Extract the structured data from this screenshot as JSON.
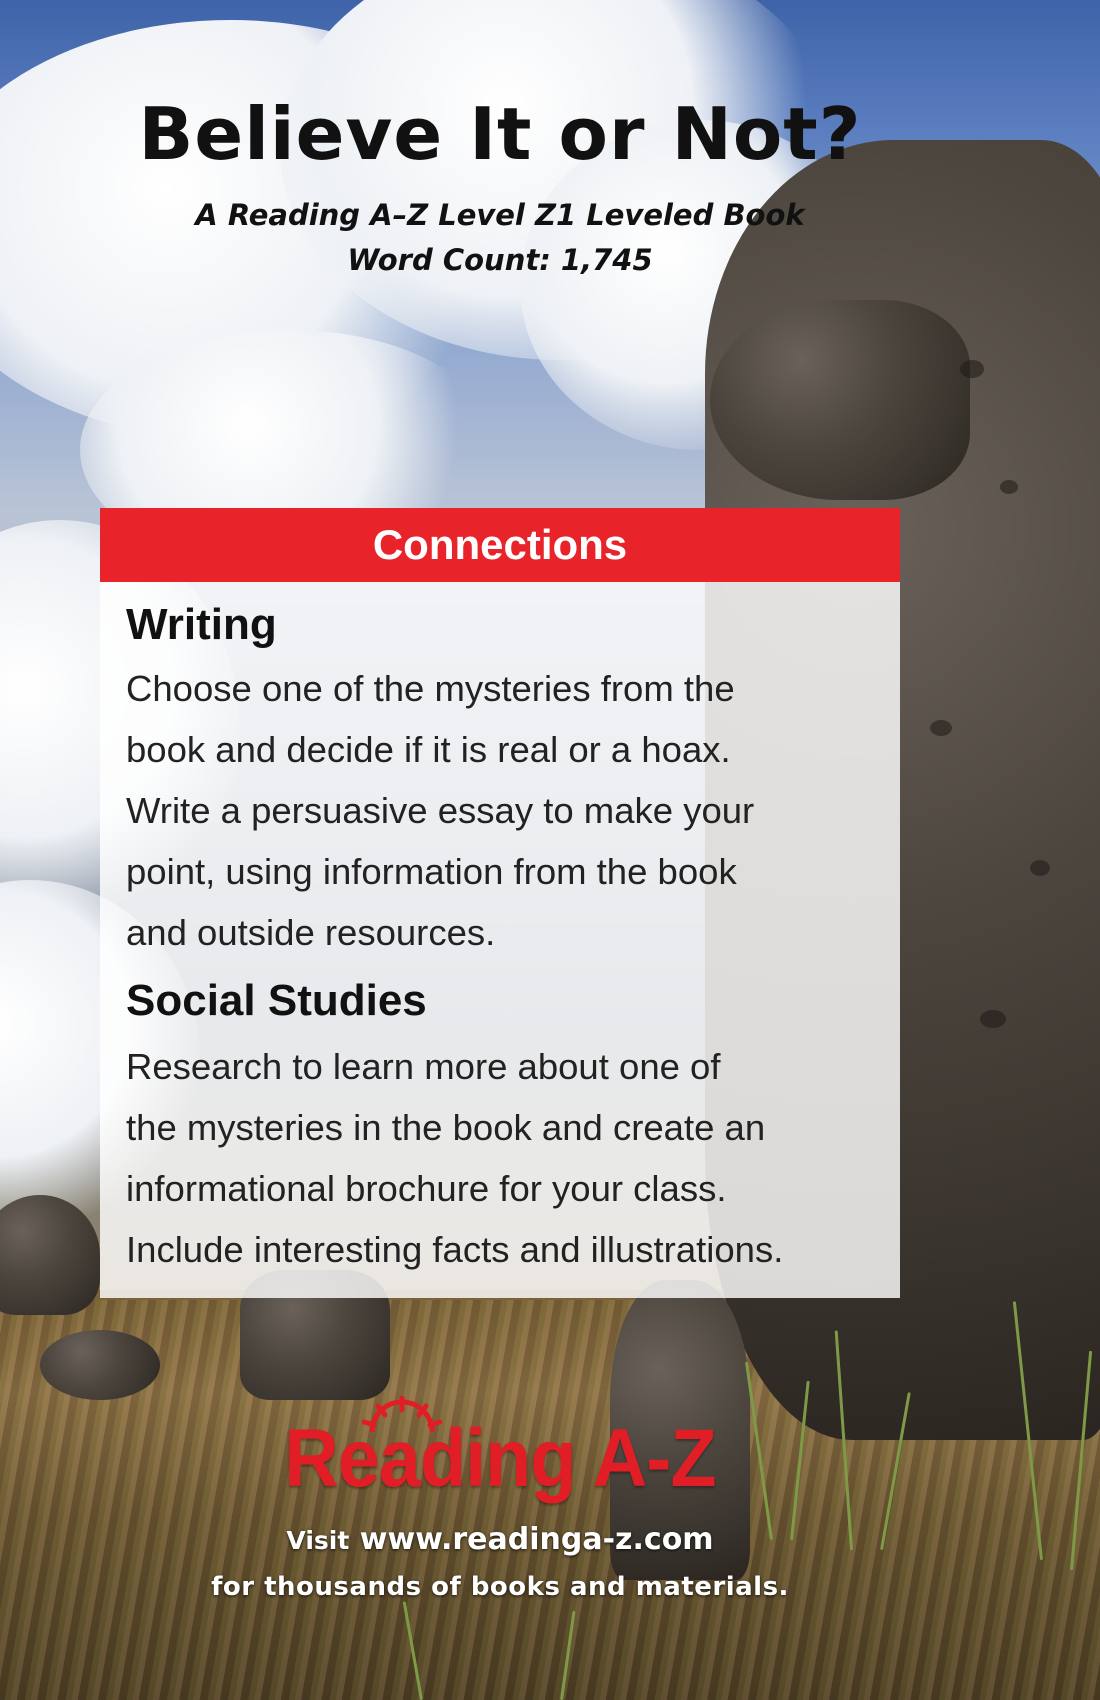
{
  "cover": {
    "title": "Believe It or Not?",
    "level_line": "A Reading A–Z Level Z1 Leveled Book",
    "word_count_line": "Word Count: 1,745"
  },
  "connections": {
    "heading": "Connections",
    "sections": [
      {
        "heading": "Writing",
        "lines": [
          "Choose one of the mysteries from the",
          "book and decide if it is real or a hoax.",
          "Write a persuasive essay to make your",
          "point, using information from the book",
          "and outside resources."
        ]
      },
      {
        "heading": "Social Studies",
        "lines": [
          "Research to learn more about one of",
          "the mysteries in the book and create an",
          "informational brochure for your class.",
          "Include interesting facts and illustrations."
        ]
      }
    ]
  },
  "footer": {
    "logo_text": "Reading A-Z",
    "visit_word": "Visit",
    "url": "www.readinga-z.com",
    "tagline": "for thousands of books and materials."
  },
  "colors": {
    "accent_red": "#e8232a",
    "logo_red": "#e11d26"
  }
}
